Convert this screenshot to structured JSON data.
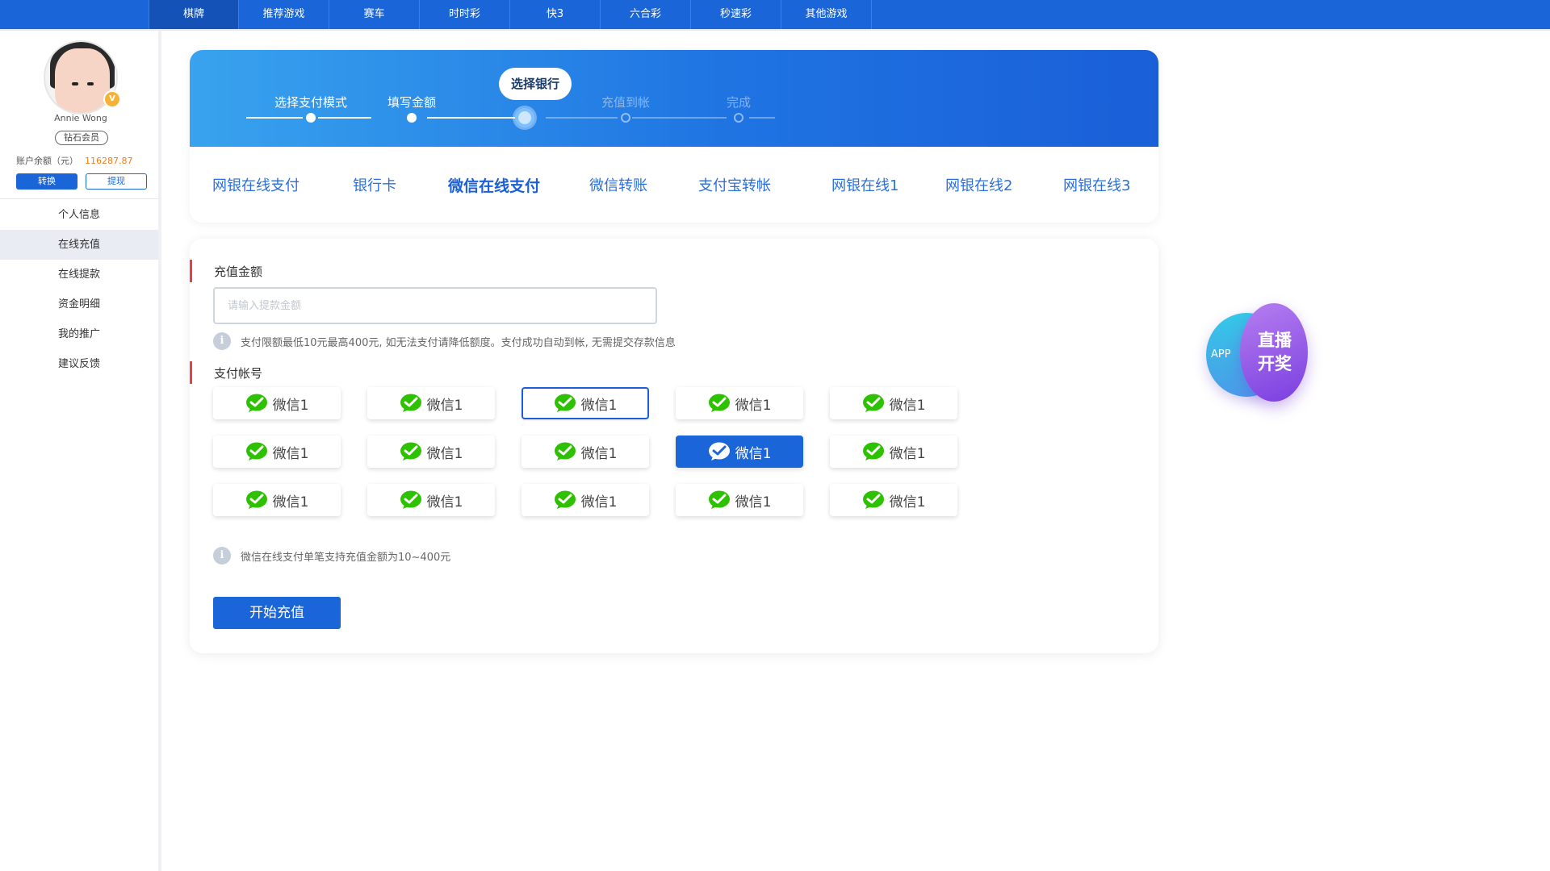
{
  "topnav": {
    "tabs": [
      "棋牌",
      "推荐游戏",
      "赛车",
      "时时彩",
      "快3",
      "六合彩",
      "秒速彩",
      "其他游戏"
    ],
    "active_index": 0
  },
  "user": {
    "name": "Annie Wong",
    "member_level": "钻石会员",
    "balance_label": "账户余额（元）",
    "balance": "116287.87",
    "vip_badge": "V"
  },
  "sidebar": {
    "convert_label": "转换",
    "withdraw_label": "提现",
    "menu": [
      "个人信息",
      "在线充值",
      "在线提款",
      "资金明细",
      "我的推广",
      "建议反馈"
    ],
    "active_index": 1
  },
  "steps": {
    "items": [
      "选择支付模式",
      "填写金额",
      "选择银行",
      "充值到帐",
      "完成"
    ],
    "current_index": 2
  },
  "payment_methods": {
    "items": [
      "网银在线支付",
      "银行卡",
      "微信在线支付",
      "微信转账",
      "支付宝转帐",
      "网银在线1",
      "网银在线2",
      "网银在线3"
    ],
    "active_index": 2
  },
  "form": {
    "amount_title": "充值金额",
    "amount_placeholder": "请输入提款金额",
    "amount_value": "",
    "limit_note": "支付限额最低10元最高400元, 如无法支付请降低额度。支付成功自动到帐, 无需提交存款信息",
    "account_title": "支付帐号",
    "account_label": "微信1",
    "accounts_count": 15,
    "outlined_index": 2,
    "selected_index": 8,
    "wechat_note": "微信在线支付单笔支持充值金额为10~400元",
    "submit_label": "开始充值",
    "info_glyph": "i"
  },
  "live_badge": {
    "app_label": "APP",
    "line1": "直播",
    "line2": "开奖"
  },
  "colors": {
    "primary": "#1a66d9",
    "accent_red": "#e3424c",
    "balance_orange": "#f07d1a",
    "wechat_green": "#2dc100"
  }
}
